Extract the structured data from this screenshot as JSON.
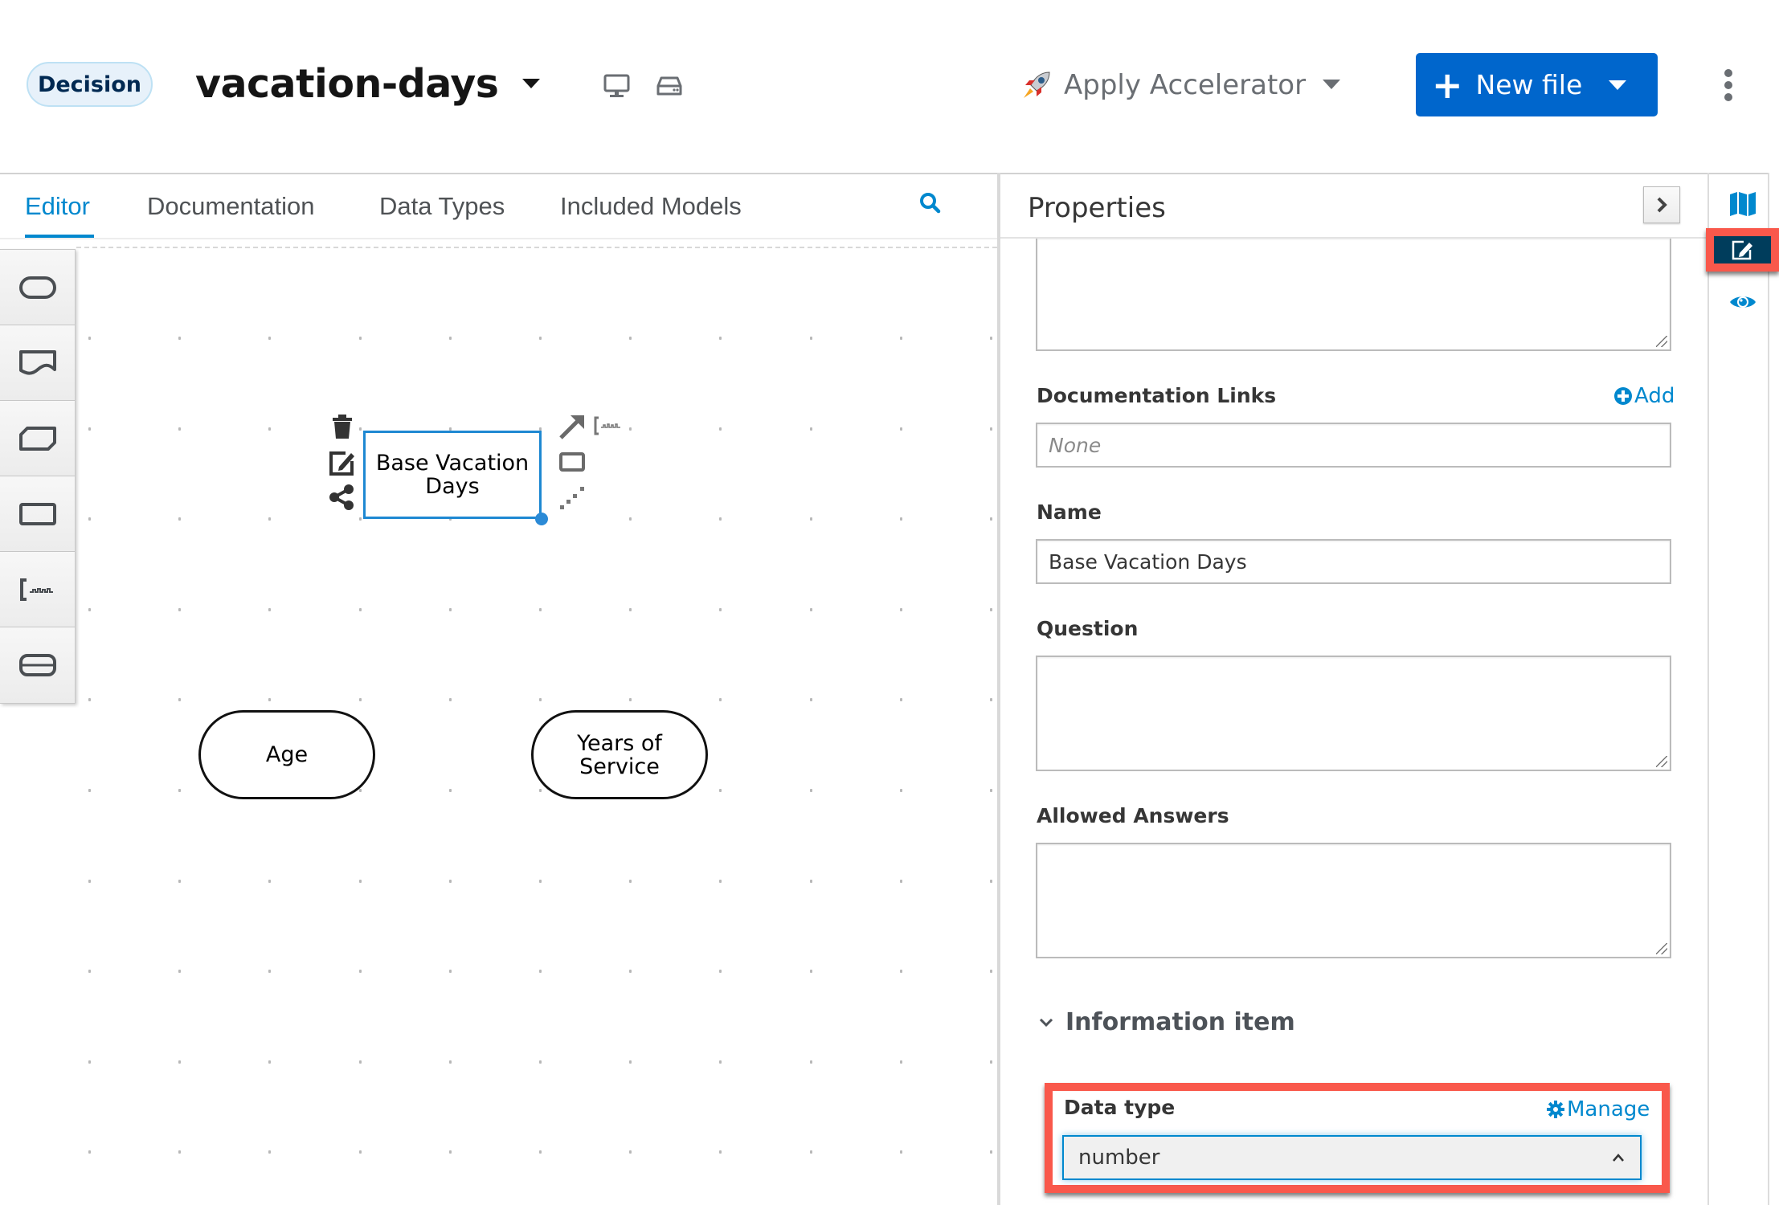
{
  "header": {
    "badge": "Decision",
    "file_name": "vacation-days",
    "icons": [
      "desktop-icon",
      "drive-icon"
    ],
    "accelerator": {
      "icon": "rocket-icon",
      "label": "Apply Accelerator"
    },
    "new_file": {
      "label": "New file",
      "icon": "plus-icon"
    },
    "more_icon": "kebab-icon"
  },
  "tabs": [
    {
      "label": "Editor",
      "active": true
    },
    {
      "label": "Documentation",
      "active": false
    },
    {
      "label": "Data Types",
      "active": false
    },
    {
      "label": "Included Models",
      "active": false
    }
  ],
  "palette": [
    {
      "name": "input-data",
      "icon": "input-data-icon"
    },
    {
      "name": "knowledge-source",
      "icon": "knowledge-source-icon"
    },
    {
      "name": "business-knowledge-model",
      "icon": "bkm-icon"
    },
    {
      "name": "decision",
      "icon": "decision-icon"
    },
    {
      "name": "text-annotation",
      "icon": "text-annotation-icon"
    },
    {
      "name": "decision-service",
      "icon": "decision-service-icon"
    }
  ],
  "canvas": {
    "selected_node": {
      "label_line1": "Base Vacation",
      "label_line2": "Days",
      "type": "decision"
    },
    "nodes": [
      {
        "label_line1": "Age",
        "label_line2": "",
        "type": "input-data"
      },
      {
        "label_line1": "Years of",
        "label_line2": "Service",
        "type": "input-data"
      }
    ],
    "node_toolbox_left": [
      "trash-icon",
      "edit-icon",
      "share-icon"
    ],
    "node_toolbox_right": [
      "connector-arrow-icon",
      "text-annotation-icon",
      "rectangle-icon",
      "dotted-connector-icon"
    ]
  },
  "properties": {
    "title": "Properties",
    "doc_links": {
      "label": "Documentation Links",
      "add_label": "Add",
      "placeholder": "None"
    },
    "name": {
      "label": "Name",
      "value": "Base Vacation Days"
    },
    "question": {
      "label": "Question",
      "value": ""
    },
    "allowed_answers": {
      "label": "Allowed Answers",
      "value": ""
    },
    "information_item": {
      "section_label": "Information item",
      "data_type_label": "Data type",
      "manage_label": "Manage",
      "data_type_value": "number"
    }
  },
  "right_rail": [
    "map-icon",
    "edit-properties-icon",
    "preview-eye-icon"
  ],
  "colors": {
    "accent": "#0088ce",
    "primary_button": "#0066cc",
    "highlight": "#f9584b",
    "rail_active": "#003d5c"
  }
}
